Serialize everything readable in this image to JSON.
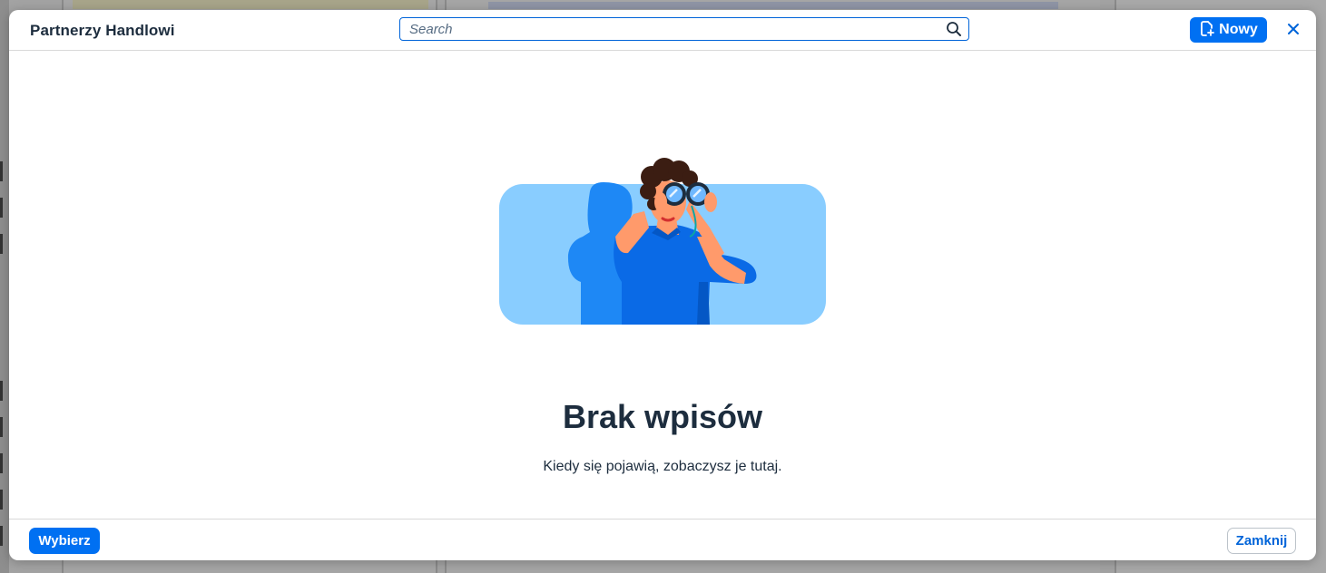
{
  "dialog": {
    "title": "Partnerzy Handlowi",
    "search": {
      "placeholder": "Search",
      "value": ""
    },
    "new_button_label": "Nowy",
    "close_icon": "close-icon"
  },
  "empty_state": {
    "title": "Brak wpisów",
    "subtitle": "Kiedy się pojawią, zobaczysz je tutaj.",
    "illustration": "person-with-binoculars"
  },
  "footer": {
    "select_label": "Wybierz",
    "close_label": "Zamknij"
  },
  "colors": {
    "accent": "#0070f2",
    "text": "#1d2d3e",
    "illustration_bg": "#89cdff"
  }
}
